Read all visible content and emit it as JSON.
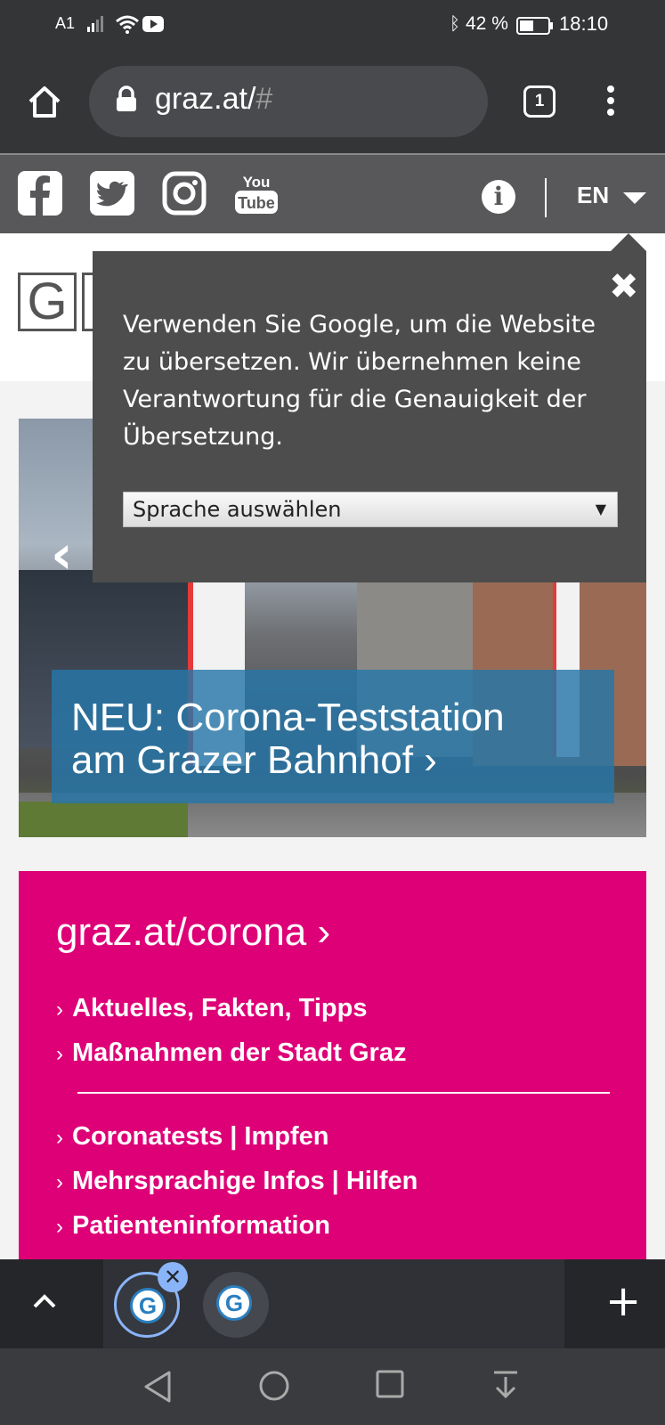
{
  "status_bar": {
    "carrier": "A1",
    "battery_percent": "42 %",
    "time": "18:10"
  },
  "browser": {
    "url_main": "graz.at/",
    "url_hash": "#",
    "tab_count": "1"
  },
  "social": {
    "icons": [
      "facebook-icon",
      "twitter-icon",
      "instagram-icon",
      "youtube-icon"
    ],
    "language": "EN"
  },
  "logo": {
    "letter": "G"
  },
  "translate_popup": {
    "close": "✖",
    "text": "Verwenden Sie Google, um die Website zu übersetzen. Wir übernehmen keine Verantwortung für die Genauigkeit der Übersetzung.",
    "select_value": "Sprache auswählen",
    "select_arrow": "▼"
  },
  "hero": {
    "prev_arrow": "‹",
    "caption_line1": "NEU: Corona-Teststation",
    "caption_line2": "am Grazer Bahnhof",
    "caption_chevron": "›"
  },
  "corona": {
    "title": "graz.at/corona",
    "title_chevron": "›",
    "links": [
      "Aktuelles, Fakten, Tipps",
      "Maßnahmen der Stadt Graz",
      "Coronatests | Impfen",
      "Mehrsprachige Infos | Hilfen",
      "Patienteninformation"
    ],
    "link_chevron": "›"
  },
  "tab_strip": {
    "tab_letter": "G",
    "close": "✕",
    "plus": "+"
  },
  "colors": {
    "chrome_dark": "#343537",
    "site_bar": "#58585a",
    "corona_pink": "#de0077",
    "caption_blue": "#2676a8",
    "popup_bg": "#4d4d4d"
  }
}
